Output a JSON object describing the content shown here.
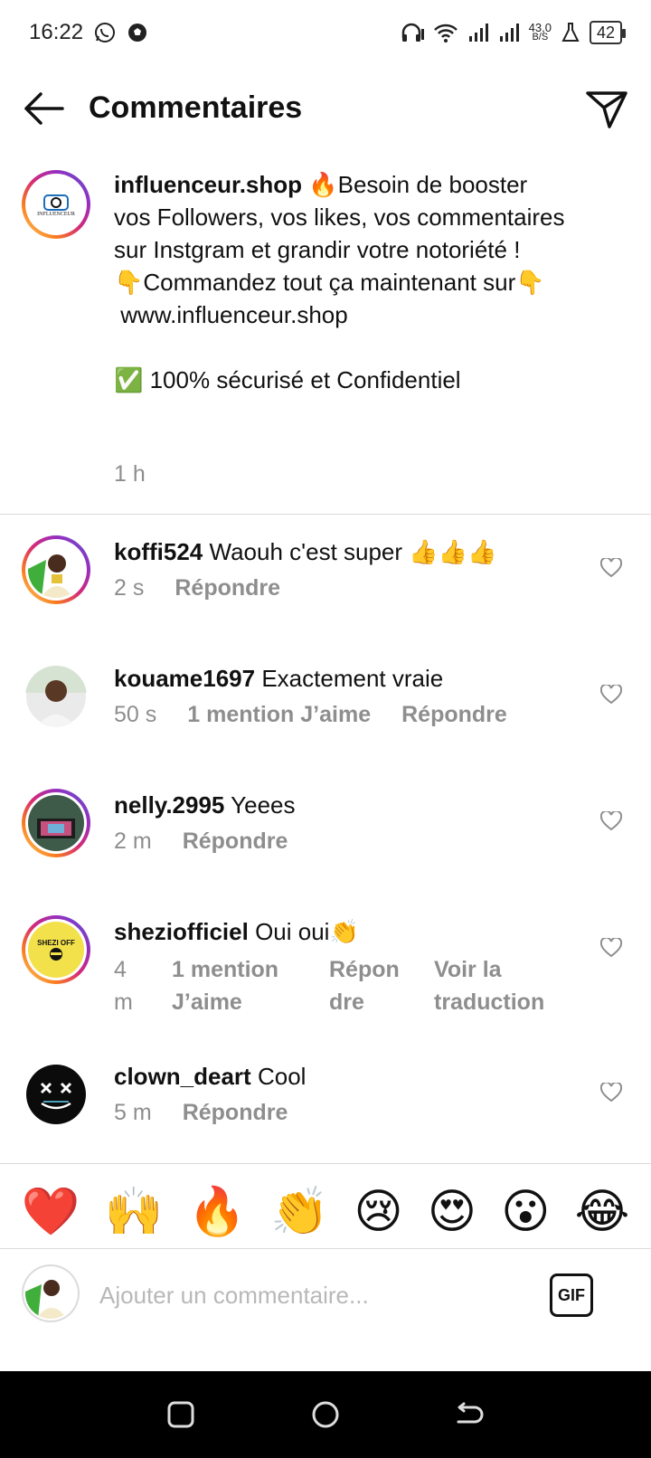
{
  "status_bar": {
    "time": "16:22",
    "net_speed_value": "43,0",
    "net_speed_unit": "B/S",
    "battery": "42",
    "icons": [
      "whatsapp-icon",
      "soccer-ball-icon",
      "headphones-icon",
      "wifi-icon",
      "signal-icon",
      "signal-icon",
      "lab-icon",
      "battery-icon"
    ]
  },
  "header": {
    "title": "Commentaires"
  },
  "caption": {
    "username": "influenceur.shop",
    "text": " 🔥Besoin de booster vos Followers, vos likes, vos commentaires sur Instgram et grandir votre notoriété !\n👇Commandez tout ça maintenant sur👇\n www.influenceur.shop\n\n✅ 100% sécurisé et Confidentiel",
    "time": "1 h",
    "avatar_text": "INFLUENCEUR"
  },
  "comments": [
    {
      "username": "koffi524",
      "text": "Waouh c'est super 👍👍👍",
      "time": "2 s",
      "likes": "",
      "reply": "Répondre",
      "translate": ""
    },
    {
      "username": "kouame1697",
      "text": "Exactement vraie",
      "time": "50 s",
      "likes": "1 mention J’aime",
      "reply": "Répondre",
      "translate": ""
    },
    {
      "username": "nelly.2995",
      "text": "Yeees",
      "time": "2 m",
      "likes": "",
      "reply": "Répondre",
      "translate": ""
    },
    {
      "username": "sheziofficiel",
      "text": "Oui oui👏",
      "time_line1": "4",
      "time_line2": "m",
      "likes_line1": "1 mention",
      "likes_line2": "J’aime",
      "reply_line1": "Répon",
      "reply_line2": "dre",
      "translate_line1": "Voir la",
      "translate_line2": "traduction",
      "avatar_text": "SHEZI OFF"
    },
    {
      "username": "clown_deart",
      "text": "Cool",
      "time": "5 m",
      "likes": "",
      "reply": "Répondre",
      "translate": ""
    }
  ],
  "emoji_bar": [
    "❤️",
    "🙌",
    "🔥",
    "👏",
    "😢",
    "😍",
    "😮",
    "😂"
  ],
  "input": {
    "placeholder": "Ajouter un commentaire...",
    "gif_label": "GIF"
  }
}
